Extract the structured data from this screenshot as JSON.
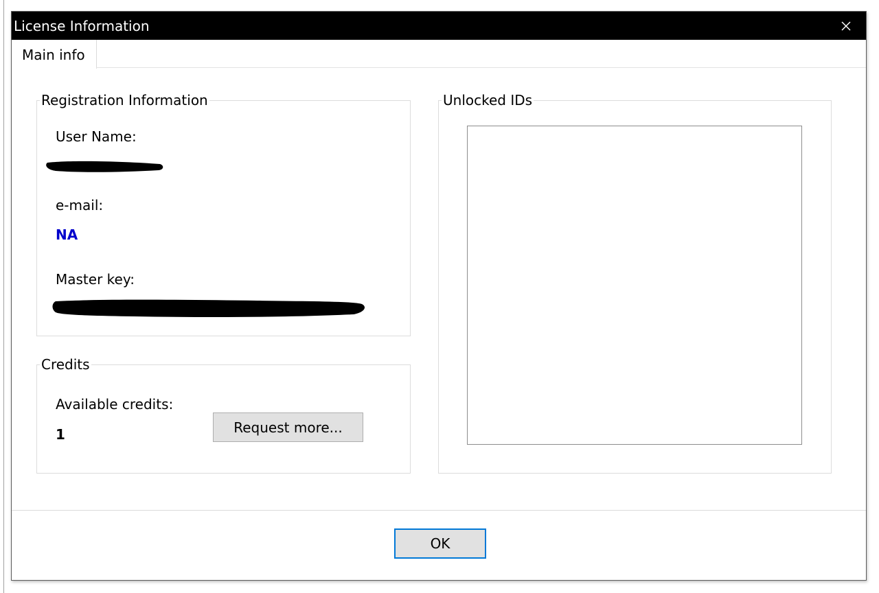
{
  "window": {
    "title": "License Information"
  },
  "tabs": [
    {
      "label": "Main info"
    }
  ],
  "registration": {
    "legend": "Registration Information",
    "user_name_label": "User Name:",
    "email_label": "e-mail:",
    "email_value": "NA",
    "master_key_label": "Master key:"
  },
  "credits": {
    "legend": "Credits",
    "available_label": "Available credits:",
    "available_value": "1",
    "request_button": "Request more..."
  },
  "unlocked": {
    "legend": "Unlocked IDs"
  },
  "footer": {
    "ok_button": "OK"
  },
  "colors": {
    "titlebar": "#000000",
    "email_value": "#0000cc",
    "ok_focus_border": "#0078d7"
  },
  "icons": {
    "close": "close-icon"
  }
}
